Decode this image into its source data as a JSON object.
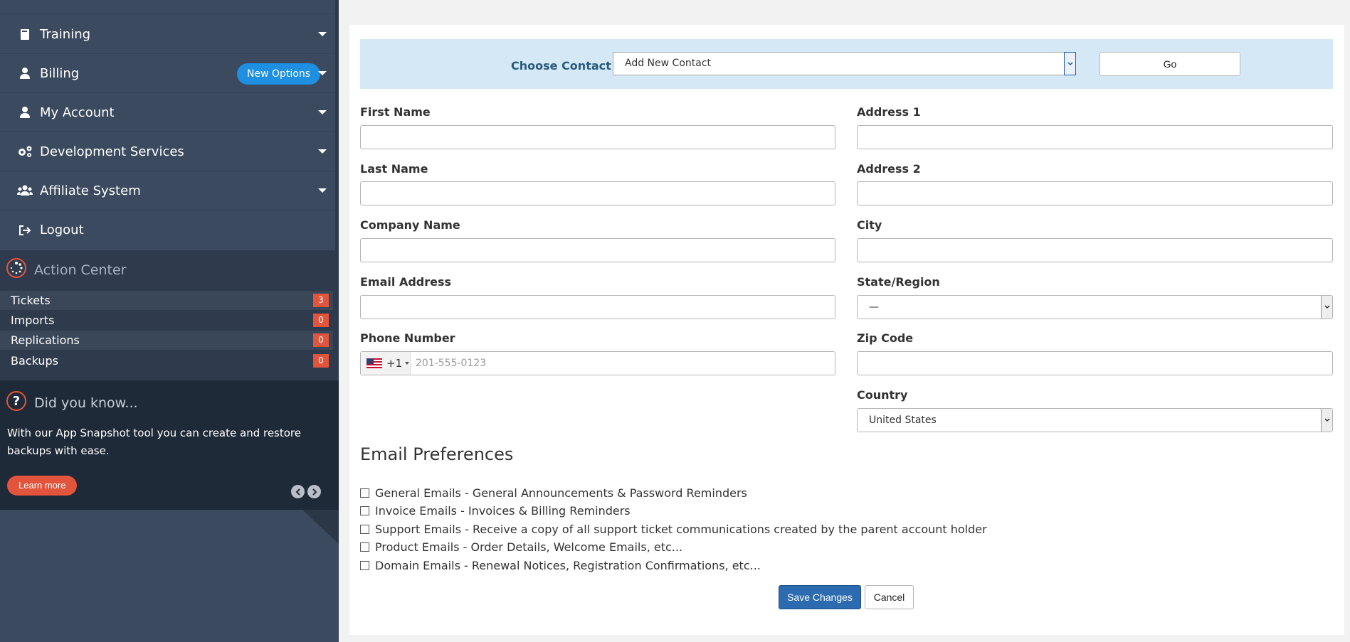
{
  "sidebar": {
    "nav": [
      {
        "label": "Training",
        "icon": "book-icon"
      },
      {
        "label": "Billing",
        "icon": "user-icon",
        "badge": "New Options"
      },
      {
        "label": "My Account",
        "icon": "user-icon"
      },
      {
        "label": "Development Services",
        "icon": "gears-icon"
      },
      {
        "label": "Affiliate System",
        "icon": "users-icon"
      },
      {
        "label": "Logout",
        "icon": "sign-out-icon"
      }
    ],
    "action_center": {
      "title": "Action Center",
      "items": [
        {
          "label": "Tickets",
          "count": "3"
        },
        {
          "label": "Imports",
          "count": "0"
        },
        {
          "label": "Replications",
          "count": "0"
        },
        {
          "label": "Backups",
          "count": "0"
        }
      ]
    },
    "did_you_know": {
      "title": "Did you know...",
      "text": "With our App Snapshot tool you can create and restore backups with ease.",
      "learn_more": "Learn more"
    }
  },
  "form": {
    "choose_contact_label": "Choose Contact",
    "contact_select_value": "Add New Contact",
    "go_label": "Go",
    "fields": {
      "first_name": "First Name",
      "last_name": "Last Name",
      "company_name": "Company Name",
      "email": "Email Address",
      "phone": "Phone Number",
      "address1": "Address 1",
      "address2": "Address 2",
      "city": "City",
      "state": "State/Region",
      "zip": "Zip Code",
      "country": "Country"
    },
    "phone_code": "+1",
    "phone_placeholder": "201-555-0123",
    "state_value": "—",
    "country_value": "United States",
    "email_prefs_title": "Email Preferences",
    "prefs": [
      "General Emails - General Announcements & Password Reminders",
      "Invoice Emails - Invoices & Billing Reminders",
      "Support Emails - Receive a copy of all support ticket communications created by the parent account holder",
      "Product Emails - Order Details, Welcome Emails, etc...",
      "Domain Emails - Renewal Notices, Registration Confirmations, etc..."
    ],
    "save_label": "Save Changes",
    "cancel_label": "Cancel"
  },
  "colors": {
    "sidebar": "#3b4a5f",
    "badge_blue": "#1e8fe1",
    "count_red": "#e2553c",
    "primary_button": "#2d6bb0",
    "contact_bar": "#d4e8f5"
  }
}
